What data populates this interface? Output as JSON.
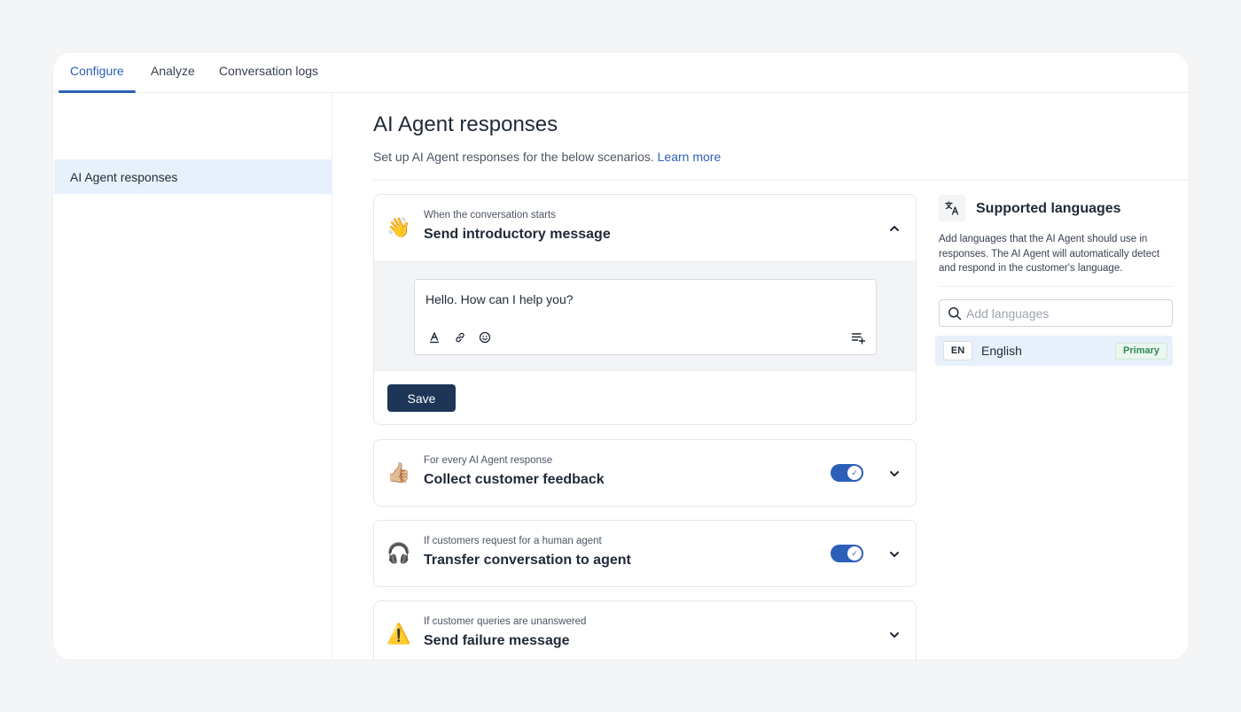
{
  "tabs": [
    {
      "label": "Configure",
      "active": true
    },
    {
      "label": "Analyze",
      "active": false
    },
    {
      "label": "Conversation logs",
      "active": false
    }
  ],
  "sidebar": {
    "items": [
      {
        "label": "AI Agent responses",
        "selected": true
      }
    ]
  },
  "main": {
    "title": "AI Agent responses",
    "subtitle": "Set up AI Agent responses for the below scenarios.",
    "learn_more": "Learn more"
  },
  "scenarios": [
    {
      "emoji": "👋",
      "pre": "When the conversation starts",
      "title": "Send introductory message",
      "expanded": true,
      "toggle": null,
      "message": "Hello. How can I help you?",
      "save_label": "Save"
    },
    {
      "emoji": "👍🏼",
      "pre": "For every AI Agent response",
      "title": "Collect customer feedback",
      "expanded": false,
      "toggle": true
    },
    {
      "emoji": "🎧",
      "pre": "If customers request for a human agent",
      "title": "Transfer conversation to agent",
      "expanded": false,
      "toggle": true
    },
    {
      "emoji": "⚠️",
      "pre": "If customer queries are unanswered",
      "title": "Send failure message",
      "expanded": false,
      "toggle": null
    }
  ],
  "languages": {
    "title": "Supported languages",
    "description": "Add languages that the AI Agent should use in responses. The AI Agent will automatically detect and respond in the customer's language.",
    "search_placeholder": "Add languages",
    "items": [
      {
        "code": "EN",
        "name": "English",
        "badge": "Primary"
      }
    ]
  },
  "colors": {
    "accent": "#2b5fb8",
    "save_button": "#1d3557",
    "selected_bg": "#e8f1fb",
    "primary_badge": "#2f8a55"
  },
  "icons": [
    "translate-icon",
    "search-icon",
    "chevron-up-icon",
    "chevron-down-icon",
    "text-format-icon",
    "link-icon",
    "emoji-icon",
    "insert-variable-icon",
    "check-icon"
  ]
}
